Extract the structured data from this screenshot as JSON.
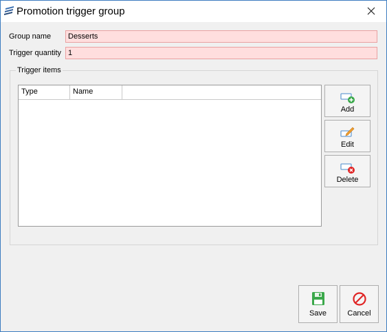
{
  "window": {
    "title": "Promotion trigger group",
    "app_icon": "app-logo-icon",
    "close_icon": "close-icon"
  },
  "form": {
    "group_name": {
      "label": "Group name",
      "value": "Desserts"
    },
    "trigger_quantity": {
      "label": "Trigger quantity",
      "value": "1"
    }
  },
  "trigger_items": {
    "title": "Trigger items",
    "columns": [
      "Type",
      "Name"
    ],
    "rows": []
  },
  "item_actions": [
    {
      "label": "Add",
      "icon": "add-item-icon"
    },
    {
      "label": "Edit",
      "icon": "edit-item-icon"
    },
    {
      "label": "Delete",
      "icon": "delete-item-icon"
    }
  ],
  "dialog_actions": {
    "save": {
      "label": "Save",
      "icon": "save-icon"
    },
    "cancel": {
      "label": "Cancel",
      "icon": "cancel-icon"
    }
  },
  "colors": {
    "invalid_field_background": "#ffdede",
    "window_border": "#3b7bbf",
    "add_green": "#3aa84a",
    "delete_red": "#e02424"
  }
}
